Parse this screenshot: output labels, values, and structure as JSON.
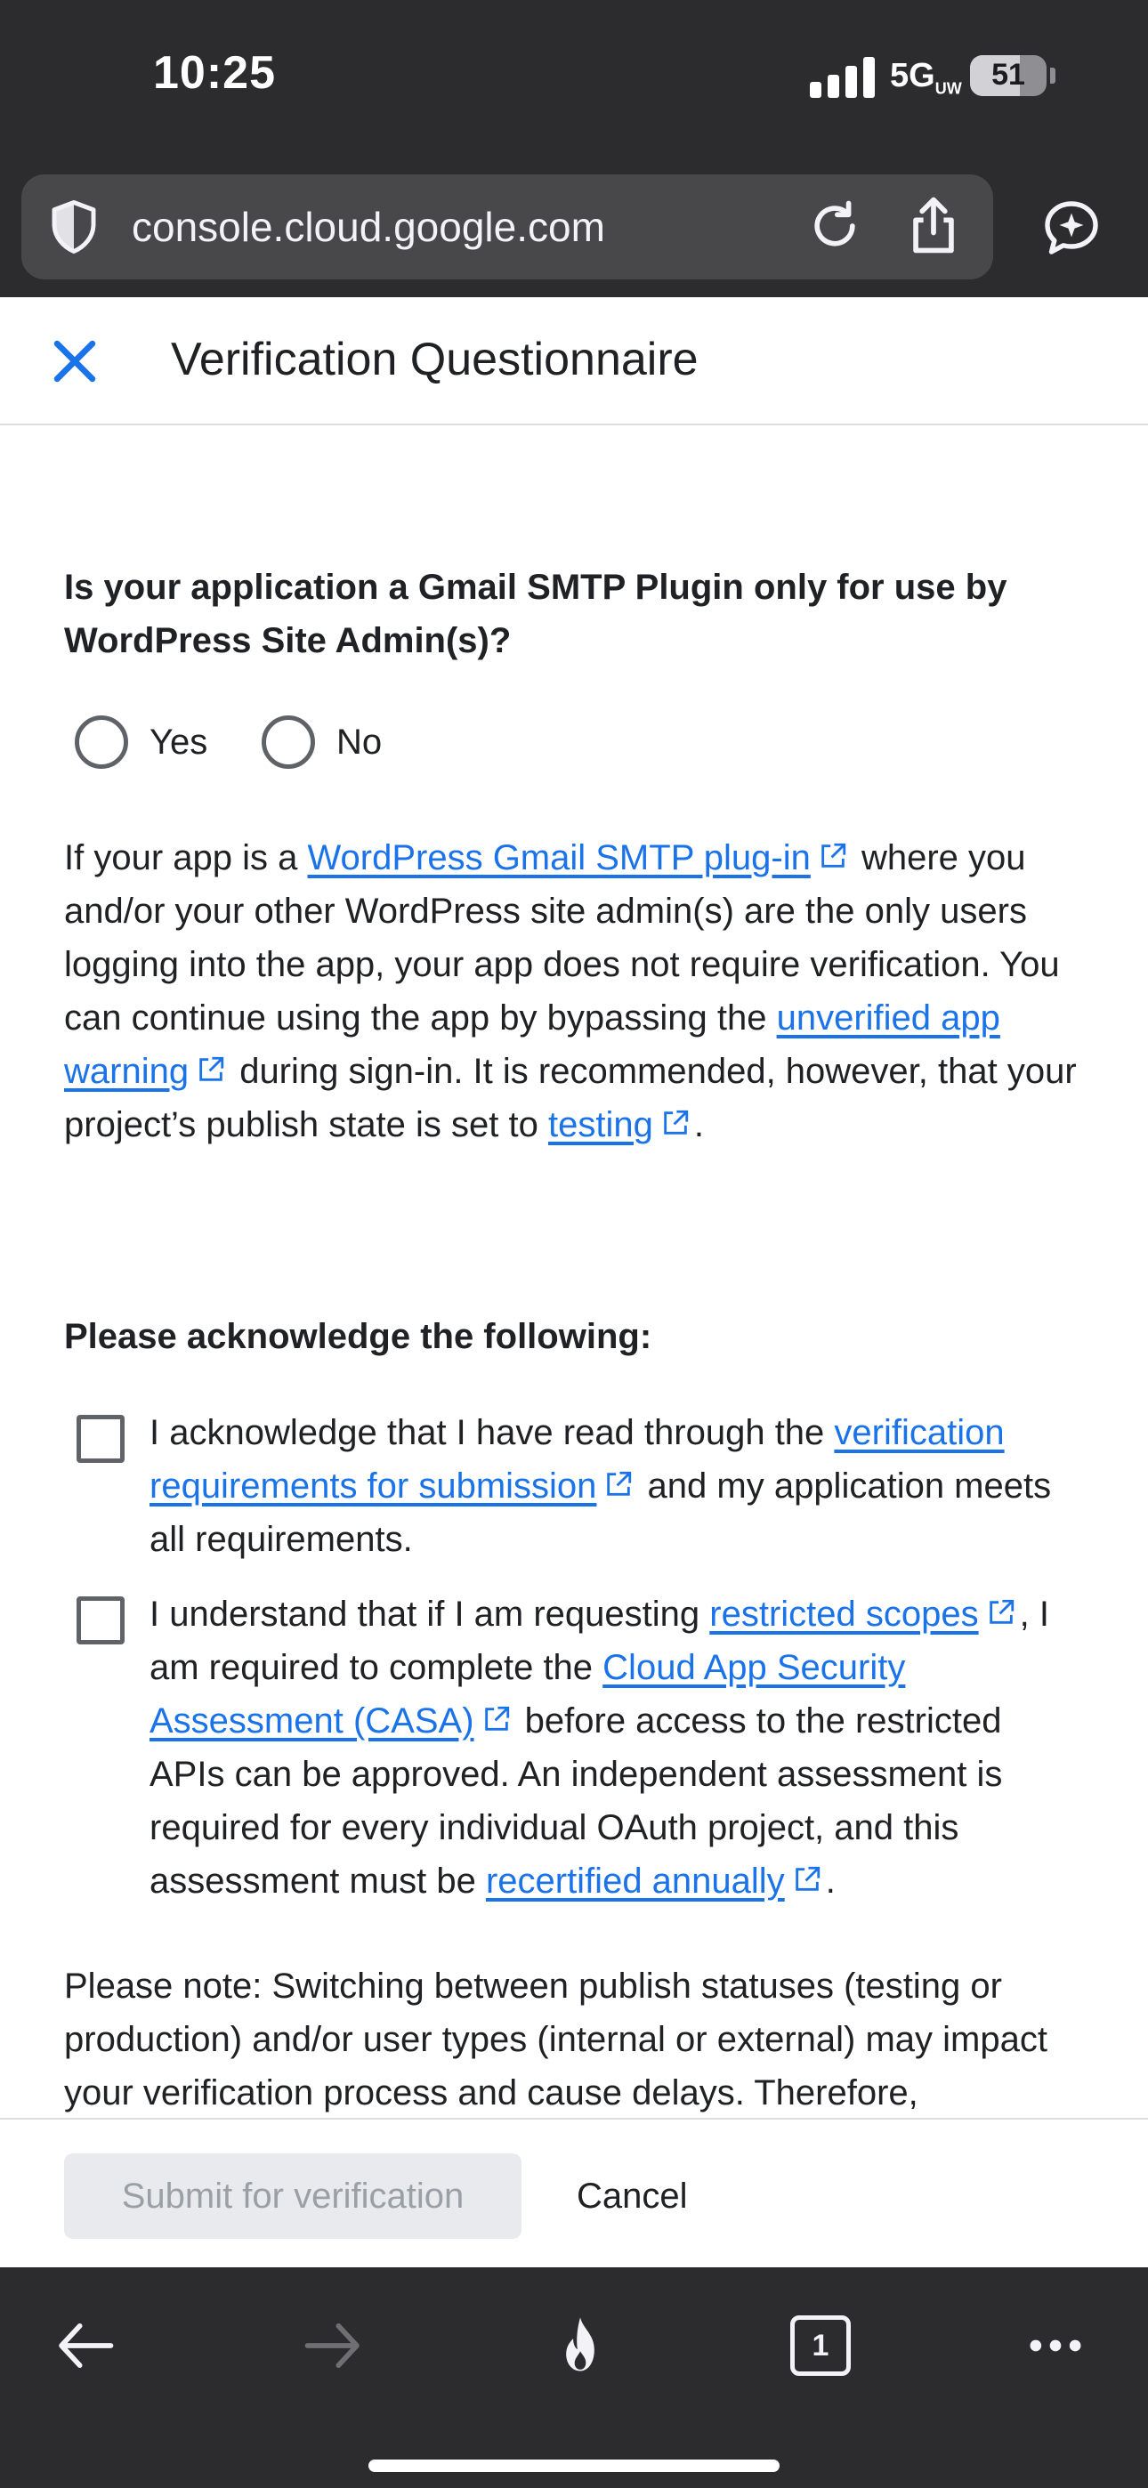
{
  "status_bar": {
    "time": "10:25",
    "network": "5G",
    "network_suffix": "UW",
    "battery": "51"
  },
  "browser": {
    "url": "console.cloud.google.com"
  },
  "header": {
    "title": "Verification Questionnaire"
  },
  "question": {
    "text": "Is your application a Gmail SMTP Plugin only for use by WordPress Site Admin(s)?",
    "options": [
      "Yes",
      "No"
    ]
  },
  "info_paragraph": {
    "part1": "If your app is a ",
    "link1": "WordPress Gmail SMTP plug-in",
    "part2": " where you and/or your other WordPress site admin(s) are the only users logging into the app, your app does not require verification. You can continue using the app by bypassing the ",
    "link2": "unverified app warning",
    "part3": " during sign-in. It is recommended, however, that your project’s publish state is set to ",
    "link3": "testing",
    "part4": "."
  },
  "acknowledge": {
    "heading": "Please acknowledge the following:",
    "item1": {
      "part1": "I acknowledge that I have read through the ",
      "link1": "verification requirements for submission",
      "part2": " and my application meets all requirements."
    },
    "item2": {
      "part1": "I understand that if I am requesting ",
      "link1": "restricted scopes",
      "part2": ", I am required to complete the ",
      "link2": "Cloud App Security Assessment (CASA)",
      "part3": " before access to the restricted APIs can be approved. An independent assessment is required for every individual OAuth project, and this assessment must be ",
      "link3": "recertified annually",
      "part4": "."
    }
  },
  "note": {
    "text": "Please note: Switching between publish statuses (testing or production) and/or user types (internal or external) may impact your verification process and cause delays. Therefore,"
  },
  "footer": {
    "submit_label": "Submit for verification",
    "cancel_label": "Cancel"
  },
  "toolbar": {
    "tab_count": "1"
  },
  "colors": {
    "link": "#1a73e8",
    "chrome_bg": "#2c2c2e",
    "disabled_button_bg": "#e8eaed"
  }
}
